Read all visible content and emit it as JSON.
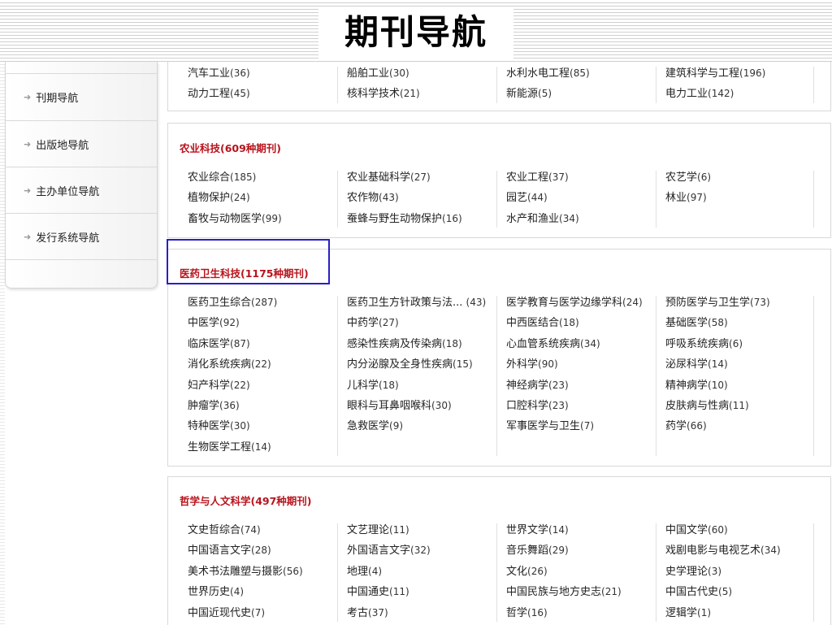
{
  "page": {
    "title": "期刊导航"
  },
  "sidebar": {
    "items": [
      {
        "label": "刊期导航"
      },
      {
        "label": "出版地导航"
      },
      {
        "label": "主办单位导航"
      },
      {
        "label": "发行系统导航"
      }
    ]
  },
  "sections": [
    {
      "title": "",
      "items": [
        [
          "汽车工业",
          "(36)"
        ],
        [
          "船舶工业",
          "(30)"
        ],
        [
          "水利水电工程",
          "(85)"
        ],
        [
          "建筑科学与工程",
          "(196)"
        ],
        [
          "动力工程",
          "(45)"
        ],
        [
          "核科学技术",
          "(21)"
        ],
        [
          "新能源",
          "(5)"
        ],
        [
          "电力工业",
          "(142)"
        ]
      ]
    },
    {
      "title": "农业科技(609种期刊)",
      "items": [
        [
          "农业综合",
          "(185)"
        ],
        [
          "农业基础科学",
          "(27)"
        ],
        [
          "农业工程",
          "(37)"
        ],
        [
          "农艺学",
          "(6)"
        ],
        [
          "植物保护",
          "(24)"
        ],
        [
          "农作物",
          "(43)"
        ],
        [
          "园艺",
          "(44)"
        ],
        [
          "林业",
          "(97)"
        ],
        [
          "畜牧与动物医学",
          "(99)"
        ],
        [
          "蚕蜂与野生动物保护",
          "(16)"
        ],
        [
          "水产和渔业",
          "(34)"
        ]
      ]
    },
    {
      "title": "医药卫生科技(1175种期刊)",
      "items": [
        [
          "医药卫生综合",
          "(287)"
        ],
        [
          "医药卫生方针政策与法... ",
          "(43)"
        ],
        [
          "医学教育与医学边缘学科",
          "(24)"
        ],
        [
          "预防医学与卫生学",
          "(73)"
        ],
        [
          "中医学",
          "(92)"
        ],
        [
          "中药学",
          "(27)"
        ],
        [
          "中西医结合",
          "(18)"
        ],
        [
          "基础医学",
          "(58)"
        ],
        [
          "临床医学",
          "(87)"
        ],
        [
          "感染性疾病及传染病",
          "(18)"
        ],
        [
          "心血管系统疾病",
          "(34)"
        ],
        [
          "呼吸系统疾病",
          "(6)"
        ],
        [
          "消化系统疾病",
          "(22)"
        ],
        [
          "内分泌腺及全身性疾病",
          "(15)"
        ],
        [
          "外科学",
          "(90)"
        ],
        [
          "泌尿科学",
          "(14)"
        ],
        [
          "妇产科学",
          "(22)"
        ],
        [
          "儿科学",
          "(18)"
        ],
        [
          "神经病学",
          "(23)"
        ],
        [
          "精神病学",
          "(10)"
        ],
        [
          "肿瘤学",
          "(36)"
        ],
        [
          "眼科与耳鼻咽喉科",
          "(30)"
        ],
        [
          "口腔科学",
          "(23)"
        ],
        [
          "皮肤病与性病",
          "(11)"
        ],
        [
          "特种医学",
          "(30)"
        ],
        [
          "急救医学",
          "(9)"
        ],
        [
          "军事医学与卫生",
          "(7)"
        ],
        [
          "药学",
          "(66)"
        ],
        [
          "生物医学工程",
          "(14)"
        ]
      ]
    },
    {
      "title": "哲学与人文科学(497种期刊)",
      "items": [
        [
          "文史哲综合",
          "(74)"
        ],
        [
          "文艺理论",
          "(11)"
        ],
        [
          "世界文学",
          "(14)"
        ],
        [
          "中国文学",
          "(60)"
        ],
        [
          "中国语言文字",
          "(28)"
        ],
        [
          "外国语言文字",
          "(32)"
        ],
        [
          "音乐舞蹈",
          "(29)"
        ],
        [
          "戏剧电影与电视艺术",
          "(34)"
        ],
        [
          "美术书法雕塑与摄影",
          "(56)"
        ],
        [
          "地理",
          "(4)"
        ],
        [
          "文化",
          "(26)"
        ],
        [
          "史学理论",
          "(3)"
        ],
        [
          "世界历史",
          "(4)"
        ],
        [
          "中国通史",
          "(11)"
        ],
        [
          "中国民族与地方史志",
          "(21)"
        ],
        [
          "中国古代史",
          "(5)"
        ],
        [
          "中国近现代史",
          "(7)"
        ],
        [
          "考古",
          "(37)"
        ],
        [
          "哲学",
          "(16)"
        ],
        [
          "逻辑学",
          "(1)"
        ]
      ]
    }
  ],
  "colors": {
    "section_title": "#b8141d",
    "highlight_box": "#2a1ec8"
  }
}
